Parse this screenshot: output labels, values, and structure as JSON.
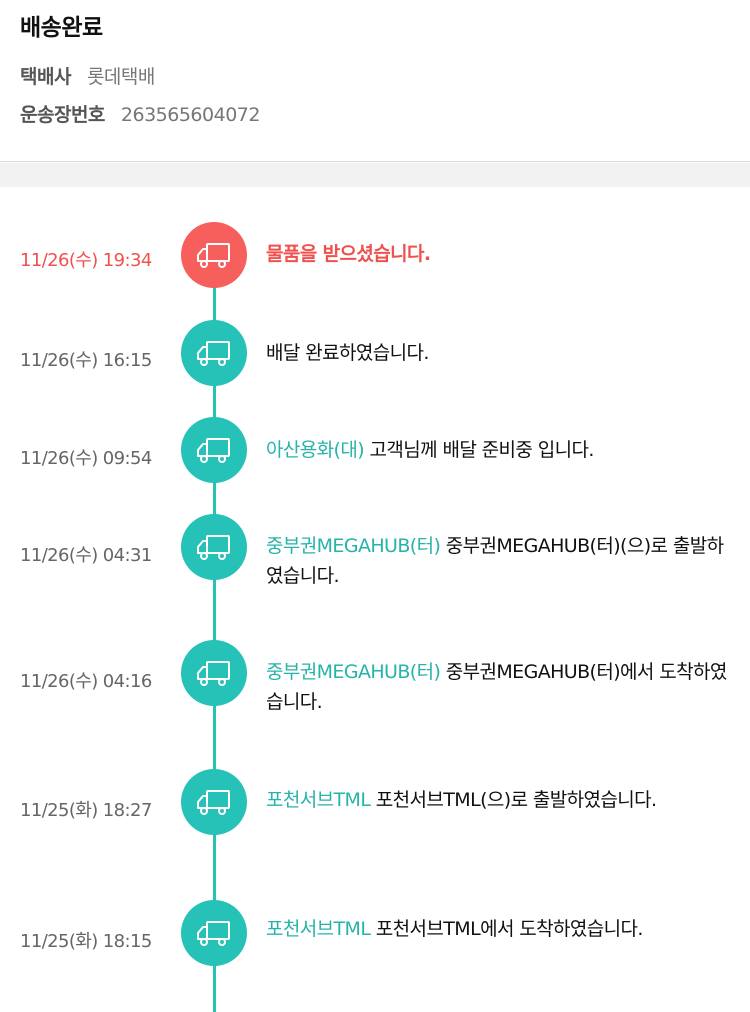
{
  "delivery": {
    "status_title": "배송완료",
    "carrier_label": "택배사",
    "carrier_value": "롯데택배",
    "tracking_label": "운송장번호",
    "tracking_value": "263565604072"
  },
  "colors": {
    "accent_teal": "#26c1b7",
    "latest_red": "#f75f5c"
  },
  "timeline": [
    {
      "time": "11/26(수) 19:34",
      "location": "",
      "message": "물품을 받으셨습니다.",
      "icon": "truck-icon"
    },
    {
      "time": "11/26(수) 16:15",
      "location": "",
      "message": "배달 완료하였습니다.",
      "icon": "truck-icon"
    },
    {
      "time": "11/26(수) 09:54",
      "location": "아산용화(대)",
      "message": "고객님께 배달 준비중 입니다.",
      "icon": "truck-icon"
    },
    {
      "time": "11/26(수) 04:31",
      "location": "중부권MEGAHUB(터)",
      "message": "중부권MEGAHUB(터)(으)로 출발하였습니다.",
      "icon": "truck-icon"
    },
    {
      "time": "11/26(수) 04:16",
      "location": "중부권MEGAHUB(터)",
      "message": "중부권MEGAHUB(터)에서 도착하였습니다.",
      "icon": "truck-icon"
    },
    {
      "time": "11/25(화) 18:27",
      "location": "포천서브TML",
      "message": "포천서브TML(으)로 출발하였습니다.",
      "icon": "truck-icon"
    },
    {
      "time": "11/25(화) 18:15",
      "location": "포천서브TML",
      "message": "포천서브TML에서 도착하였습니다.",
      "icon": "truck-icon"
    }
  ]
}
